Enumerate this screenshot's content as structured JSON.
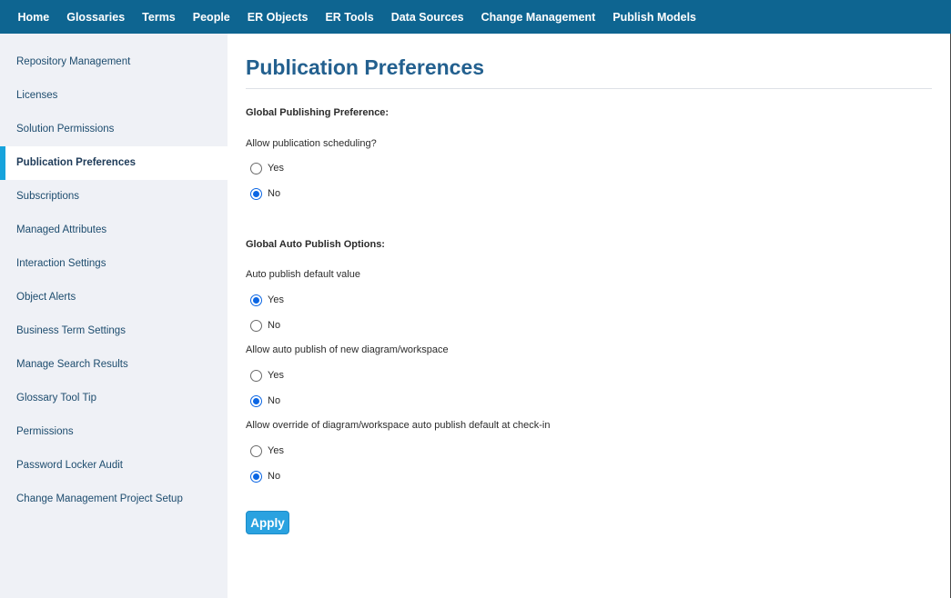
{
  "topnav": {
    "items": [
      "Home",
      "Glossaries",
      "Terms",
      "People",
      "ER Objects",
      "ER Tools",
      "Data Sources",
      "Change Management",
      "Publish Models"
    ]
  },
  "sidebar": {
    "items": [
      "Repository Management",
      "Licenses",
      "Solution Permissions",
      "Publication Preferences",
      "Subscriptions",
      "Managed Attributes",
      "Interaction Settings",
      "Object Alerts",
      "Business Term Settings",
      "Manage Search Results",
      "Glossary Tool Tip",
      "Permissions",
      "Password Locker Audit",
      "Change Management Project Setup"
    ],
    "active": "Publication Preferences"
  },
  "main": {
    "title": "Publication Preferences",
    "global_publishing": {
      "label": "Global Publishing Preference:",
      "question": "Allow publication scheduling?",
      "options": [
        "Yes",
        "No"
      ],
      "selected": "No"
    },
    "global_auto_publish": {
      "label": "Global Auto Publish Options:",
      "default_value": {
        "question": "Auto publish default value",
        "options": [
          "Yes",
          "No"
        ],
        "selected": "Yes"
      },
      "new_diagram": {
        "question": "Allow auto publish of new diagram/workspace",
        "options": [
          "Yes",
          "No"
        ],
        "selected": "No"
      },
      "override_checkin": {
        "question": "Allow override of diagram/workspace auto publish default at check-in",
        "options": [
          "Yes",
          "No"
        ],
        "selected": "No"
      }
    },
    "apply_label": "Apply"
  }
}
